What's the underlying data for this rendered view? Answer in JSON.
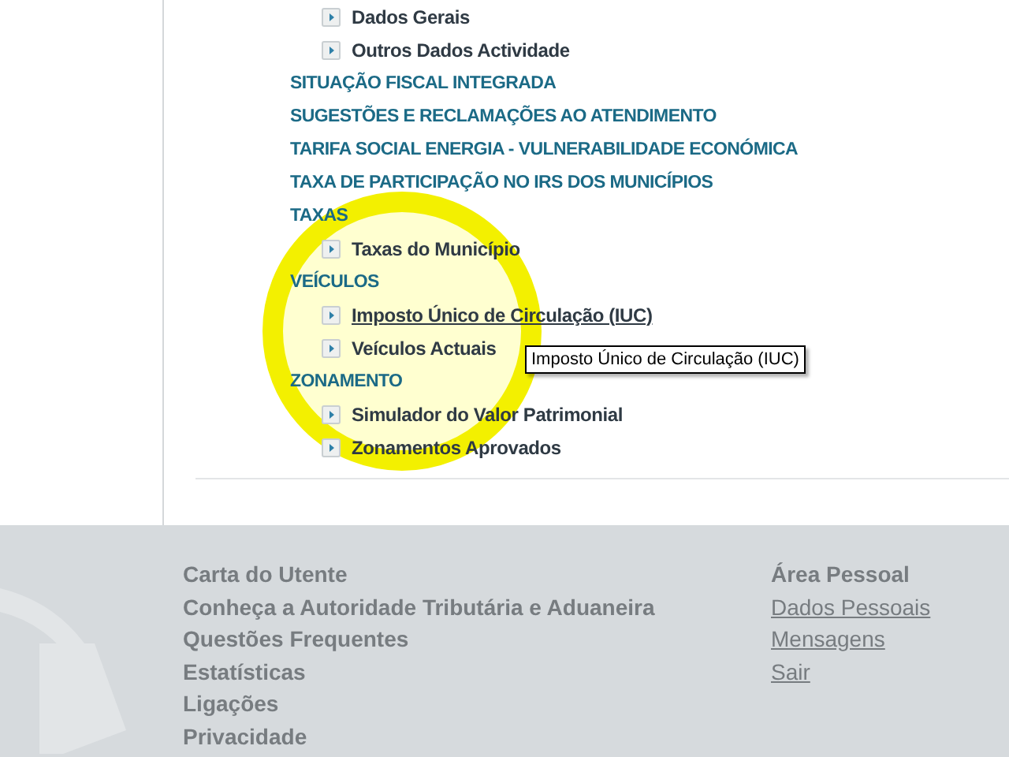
{
  "menu": [
    {
      "kind": "link",
      "label": "Dados Gerais",
      "hovered": false
    },
    {
      "kind": "link",
      "label": "Outros Dados Actividade",
      "hovered": false
    },
    {
      "kind": "section",
      "label": "SITUAÇÃO FISCAL INTEGRADA"
    },
    {
      "kind": "section",
      "label": "SUGESTÕES E RECLAMAÇÕES AO ATENDIMENTO"
    },
    {
      "kind": "section",
      "label": "TARIFA SOCIAL ENERGIA - VULNERABILIDADE ECONÓMICA"
    },
    {
      "kind": "section",
      "label": "TAXA DE PARTICIPAÇÃO NO IRS DOS MUNICÍPIOS"
    },
    {
      "kind": "section",
      "label": "TAXAS"
    },
    {
      "kind": "link",
      "label": "Taxas do Município",
      "hovered": false
    },
    {
      "kind": "section",
      "label": "VEÍCULOS"
    },
    {
      "kind": "link",
      "label": "Imposto Único de Circulação (IUC)",
      "hovered": true
    },
    {
      "kind": "link",
      "label": "Veículos Actuais",
      "hovered": false
    },
    {
      "kind": "section",
      "label": "ZONAMENTO"
    },
    {
      "kind": "link",
      "label": "Simulador do Valor Patrimonial",
      "hovered": false
    },
    {
      "kind": "link",
      "label": "Zonamentos Aprovados",
      "hovered": false
    }
  ],
  "tooltip": "Imposto Único de Circulação (IUC)",
  "footer": {
    "links": [
      "Carta do Utente",
      "Conheça a Autoridade Tributária e Aduaneira",
      "Questões Frequentes",
      "Estatísticas",
      "Ligações",
      "Privacidade"
    ],
    "personal_area": {
      "heading": "Área Pessoal",
      "links": [
        "Dados Pessoais",
        "Mensagens",
        "Sair"
      ]
    }
  }
}
